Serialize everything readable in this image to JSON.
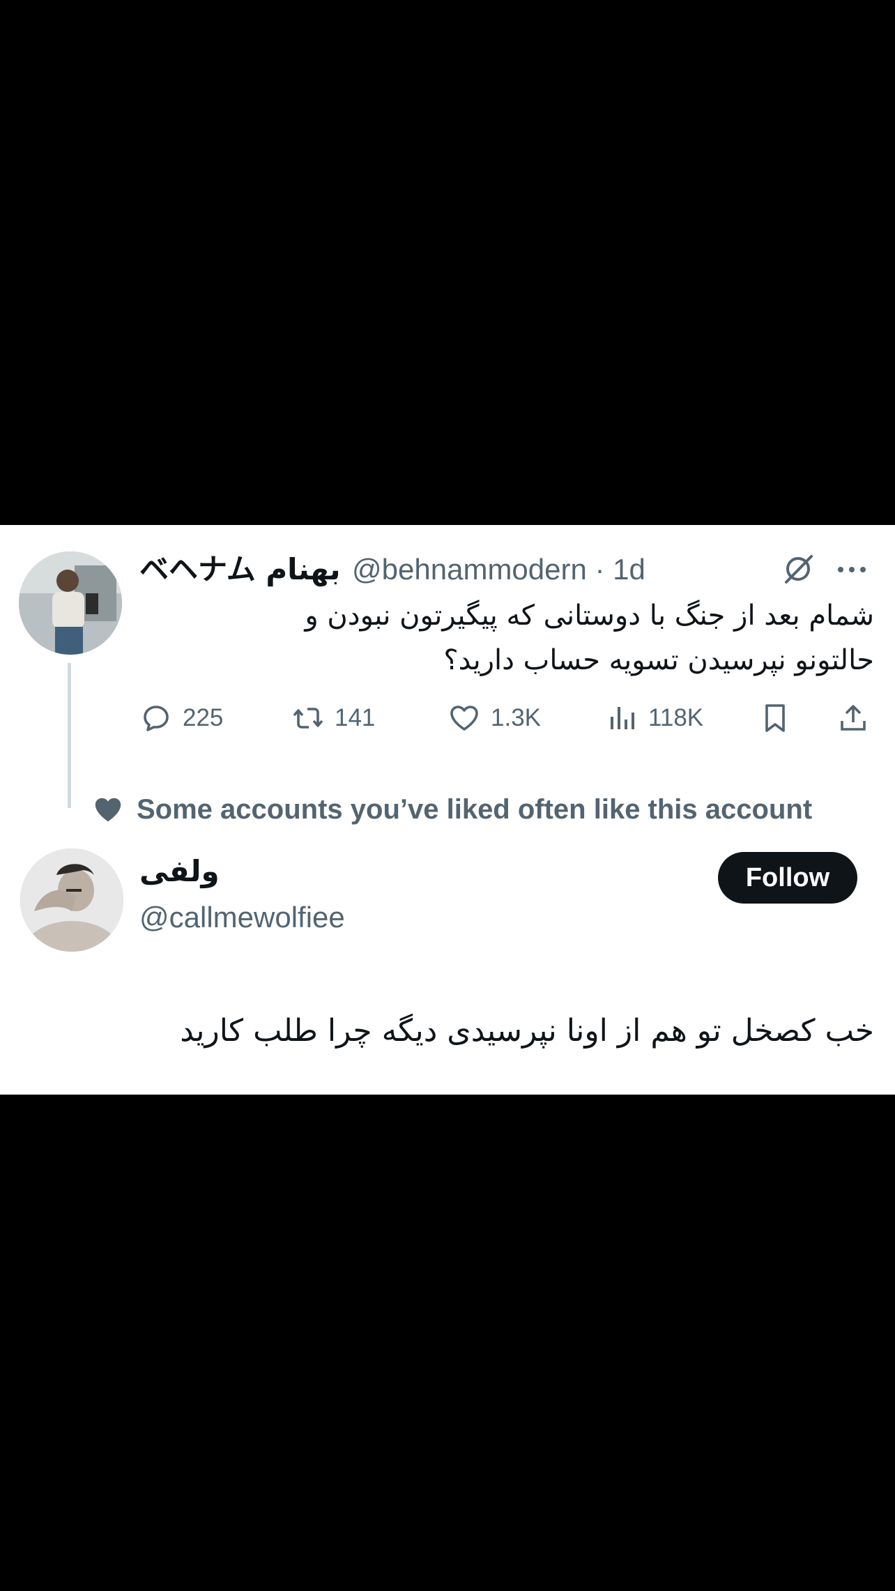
{
  "tweet": {
    "display_name": "ベヘナム بهنام",
    "handle_time": "@behnammodern · 1d",
    "text_lines": [
      "شمام بعد از جنگ با دوستانی که پیگیرتون نبودن و",
      "حالتونو نپرسیدن تسویه حساب دارید؟"
    ],
    "actions": {
      "replies": "225",
      "reposts": "141",
      "likes": "1.3K",
      "views": "118K"
    },
    "icons": [
      "grok-icon",
      "more-icon",
      "reply-icon",
      "repost-icon",
      "like-icon",
      "views-icon",
      "bookmark-icon",
      "share-icon"
    ]
  },
  "suggestion": {
    "social_context": "Some accounts you’ve liked often like this account",
    "display_name": "ولفی",
    "handle": "@callmewolfiee",
    "follow_label": "Follow"
  },
  "caption": "خب کصخل تو هم از اونا نپرسیدی دیگه چرا طلب کارید",
  "colors": {
    "background": "#000000",
    "card": "#ffffff",
    "text": "#0f1419",
    "secondary": "#536471",
    "thread_line": "#cfd9de",
    "follow_button": "#0f1419"
  }
}
